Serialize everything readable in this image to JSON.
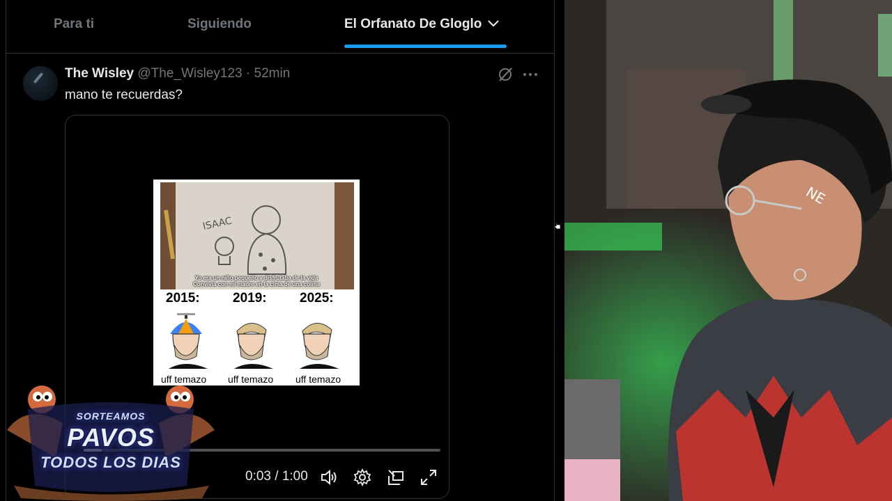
{
  "tabs": [
    {
      "label": "Para ti"
    },
    {
      "label": "Siguiendo"
    },
    {
      "label": "El Orfanato De Gloglo",
      "active": true
    }
  ],
  "tweet": {
    "name": "The Wisley",
    "handle": "@The_Wisley123",
    "separator": "·",
    "time": "52min",
    "text": "mano te recuerdas?",
    "media": {
      "captions": [
        "Yo era un niño pequeño y disfrutaba de la vida",
        "Convivía con mi madre en la cima de una colina"
      ],
      "drawing_label": "ISAAC",
      "years": [
        "2015:",
        "2019:",
        "2025:"
      ],
      "labels": [
        "uff temazo",
        "uff temazo",
        "uff temazo"
      ]
    },
    "player": {
      "time_display": "0:03 / 1:00",
      "progress": 0.05
    }
  },
  "overlay": {
    "line1": "SORTEAMOS",
    "line2": "PAVOS",
    "line3": "TODOS LOS DIAS"
  },
  "colors": {
    "accent": "#1d9bf0",
    "background": "#000000",
    "muted_text": "#71767b",
    "primary_text": "#e7e9ea"
  },
  "icons": [
    "chevron-down-icon",
    "grok-icon",
    "more-icon",
    "volume-icon",
    "settings-icon",
    "pip-icon",
    "fullscreen-icon"
  ]
}
